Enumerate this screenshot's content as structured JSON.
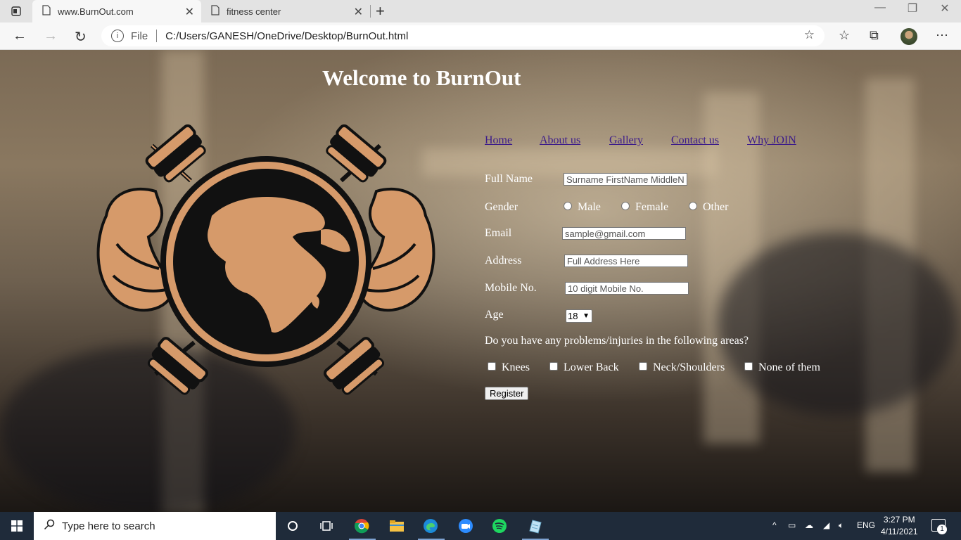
{
  "browser": {
    "tabs": [
      {
        "title": "www.BurnOut.com",
        "active": true
      },
      {
        "title": "fitness center",
        "active": false
      }
    ],
    "address": {
      "scheme_label": "File",
      "url": "C:/Users/GANESH/OneDrive/Desktop/BurnOut.html"
    }
  },
  "page": {
    "title": "Welcome to BurnOut",
    "nav": [
      "Home",
      "About us",
      "Gallery",
      "Contact us",
      "Why JOIN"
    ],
    "form": {
      "full_name": {
        "label": "Full Name",
        "placeholder": "Surname FirstName MiddleName"
      },
      "gender": {
        "label": "Gender",
        "options": [
          "Male",
          "Female",
          "Other"
        ]
      },
      "email": {
        "label": "Email",
        "placeholder": "sample@gmail.com"
      },
      "address": {
        "label": "Address",
        "placeholder": "Full Address Here"
      },
      "mobile": {
        "label": "Mobile No.",
        "placeholder": "10 digit Mobile No."
      },
      "age": {
        "label": "Age",
        "value": "18"
      },
      "injuries": {
        "question": "Do you have any problems/injuries in the following areas?",
        "options": [
          "Knees",
          "Lower Back",
          "Neck/Shoulders",
          "None of them"
        ]
      },
      "register_label": "Register"
    }
  },
  "taskbar": {
    "search_placeholder": "Type here to search",
    "language": "ENG",
    "time": "3:27 PM",
    "date": "4/11/2021",
    "notification_count": "1"
  },
  "colors": {
    "link": "#3b1a8a",
    "logo_tan": "#d69a6a",
    "logo_dark": "#111111",
    "taskbar": "#1f2b3a"
  }
}
